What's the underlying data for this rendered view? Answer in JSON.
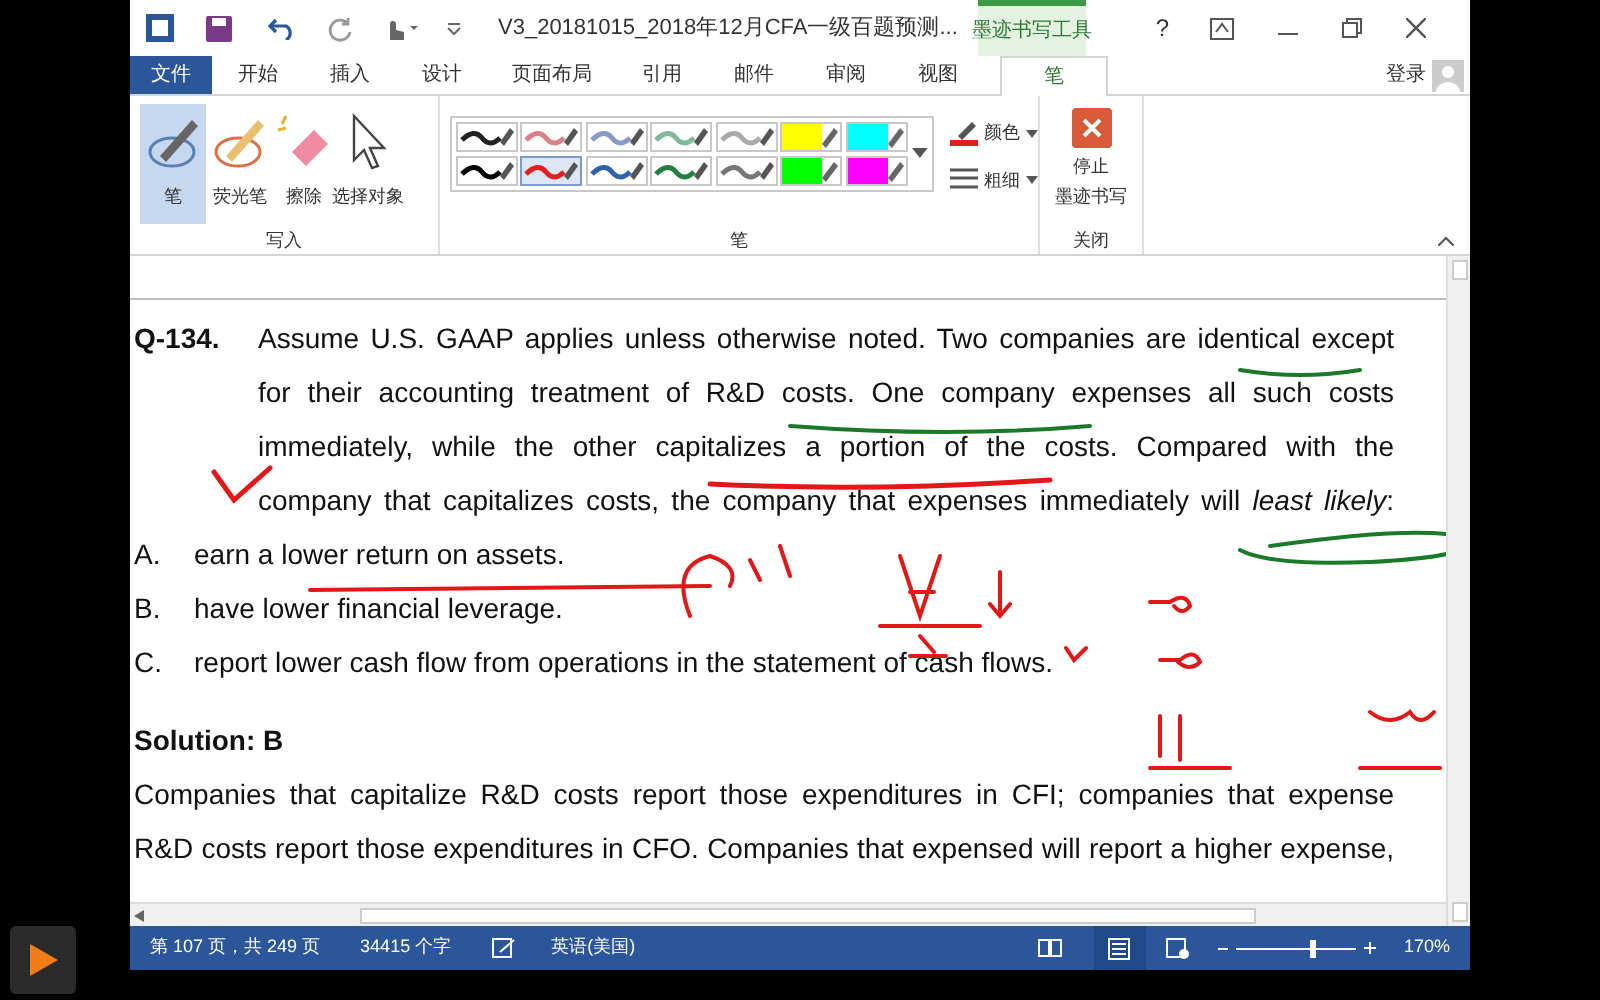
{
  "window": {
    "title": "V3_20181015_2018年12月CFA一级百题预测...",
    "context_tab": "墨迹书写工具",
    "help": "?",
    "login": "登录"
  },
  "tabs": [
    {
      "label": "文件",
      "kind": "file",
      "selected": false
    },
    {
      "label": "开始",
      "kind": "tab",
      "selected": false
    },
    {
      "label": "插入",
      "kind": "tab",
      "selected": false
    },
    {
      "label": "设计",
      "kind": "tab",
      "selected": false
    },
    {
      "label": "页面布局",
      "kind": "tab",
      "selected": false
    },
    {
      "label": "引用",
      "kind": "tab",
      "selected": false
    },
    {
      "label": "邮件",
      "kind": "tab",
      "selected": false
    },
    {
      "label": "审阅",
      "kind": "tab",
      "selected": false
    },
    {
      "label": "视图",
      "kind": "tab",
      "selected": false
    },
    {
      "label": "笔",
      "kind": "tab",
      "selected": true
    }
  ],
  "ribbon": {
    "write_tools": [
      {
        "label": "笔",
        "kind": "pen",
        "selected": true
      },
      {
        "label": "荧光笔",
        "kind": "highlighter",
        "selected": false
      },
      {
        "label": "擦除",
        "kind": "eraser",
        "selected": false
      },
      {
        "label": "选择对象",
        "kind": "select",
        "selected": false
      }
    ],
    "write_group": "写入",
    "pens": [
      {
        "kind": "pen",
        "color": "#222222",
        "selected": false
      },
      {
        "kind": "pen",
        "color": "#d9808a",
        "selected": false
      },
      {
        "kind": "pen",
        "color": "#8a9ac8",
        "selected": false
      },
      {
        "kind": "pen",
        "color": "#7fb89a",
        "selected": false
      },
      {
        "kind": "pen",
        "color": "#aaaaaa",
        "selected": false
      },
      {
        "kind": "highlighter",
        "color": "#ffff00",
        "selected": false
      },
      {
        "kind": "highlighter",
        "color": "#00ffff",
        "selected": false
      },
      {
        "kind": "pen",
        "color": "#000000",
        "selected": false
      },
      {
        "kind": "pen",
        "color": "#e02020",
        "selected": true
      },
      {
        "kind": "pen",
        "color": "#3060b0",
        "selected": false
      },
      {
        "kind": "pen",
        "color": "#208040",
        "selected": false
      },
      {
        "kind": "pen",
        "color": "#777777",
        "selected": false
      },
      {
        "kind": "highlighter",
        "color": "#00ff00",
        "selected": false
      },
      {
        "kind": "highlighter",
        "color": "#ff00ff",
        "selected": false
      }
    ],
    "color_label": "颜色",
    "thickness_label": "粗细",
    "pens_group": "笔",
    "stop_label_lines": [
      "停止",
      "墨迹书写"
    ],
    "close_group": "关闭"
  },
  "document": {
    "question_number": "Q-134.",
    "question_lines": [
      "Assume U.S. GAAP applies unless otherwise noted. Two companies are identical except",
      "for their accounting treatment of R&D costs. One company expenses all such costs",
      "immediately, while the other capitalizes a portion of the costs. Compared with the",
      "company that capitalizes costs, the company that expenses immediately will *least likely*:"
    ],
    "options": [
      {
        "letter": "A.",
        "text": "earn a lower return on assets."
      },
      {
        "letter": "B.",
        "text": "have lower financial leverage."
      },
      {
        "letter": "C.",
        "text": "report lower cash flow from operations in the statement of cash flows."
      }
    ],
    "solution_heading": "Solution: B",
    "solution_lines": [
      "Companies that capitalize R&D costs report those expenditures in CFI; companies that expense",
      "R&D costs report those expenditures in CFO. Companies that expensed will report a higher expense,"
    ]
  },
  "status_bar": {
    "page": "第 107 页，共 249 页",
    "words": "34415 个字",
    "language": "英语(美国)",
    "zoom": "170%",
    "zoom_slider": {
      "level": 0.62
    }
  }
}
